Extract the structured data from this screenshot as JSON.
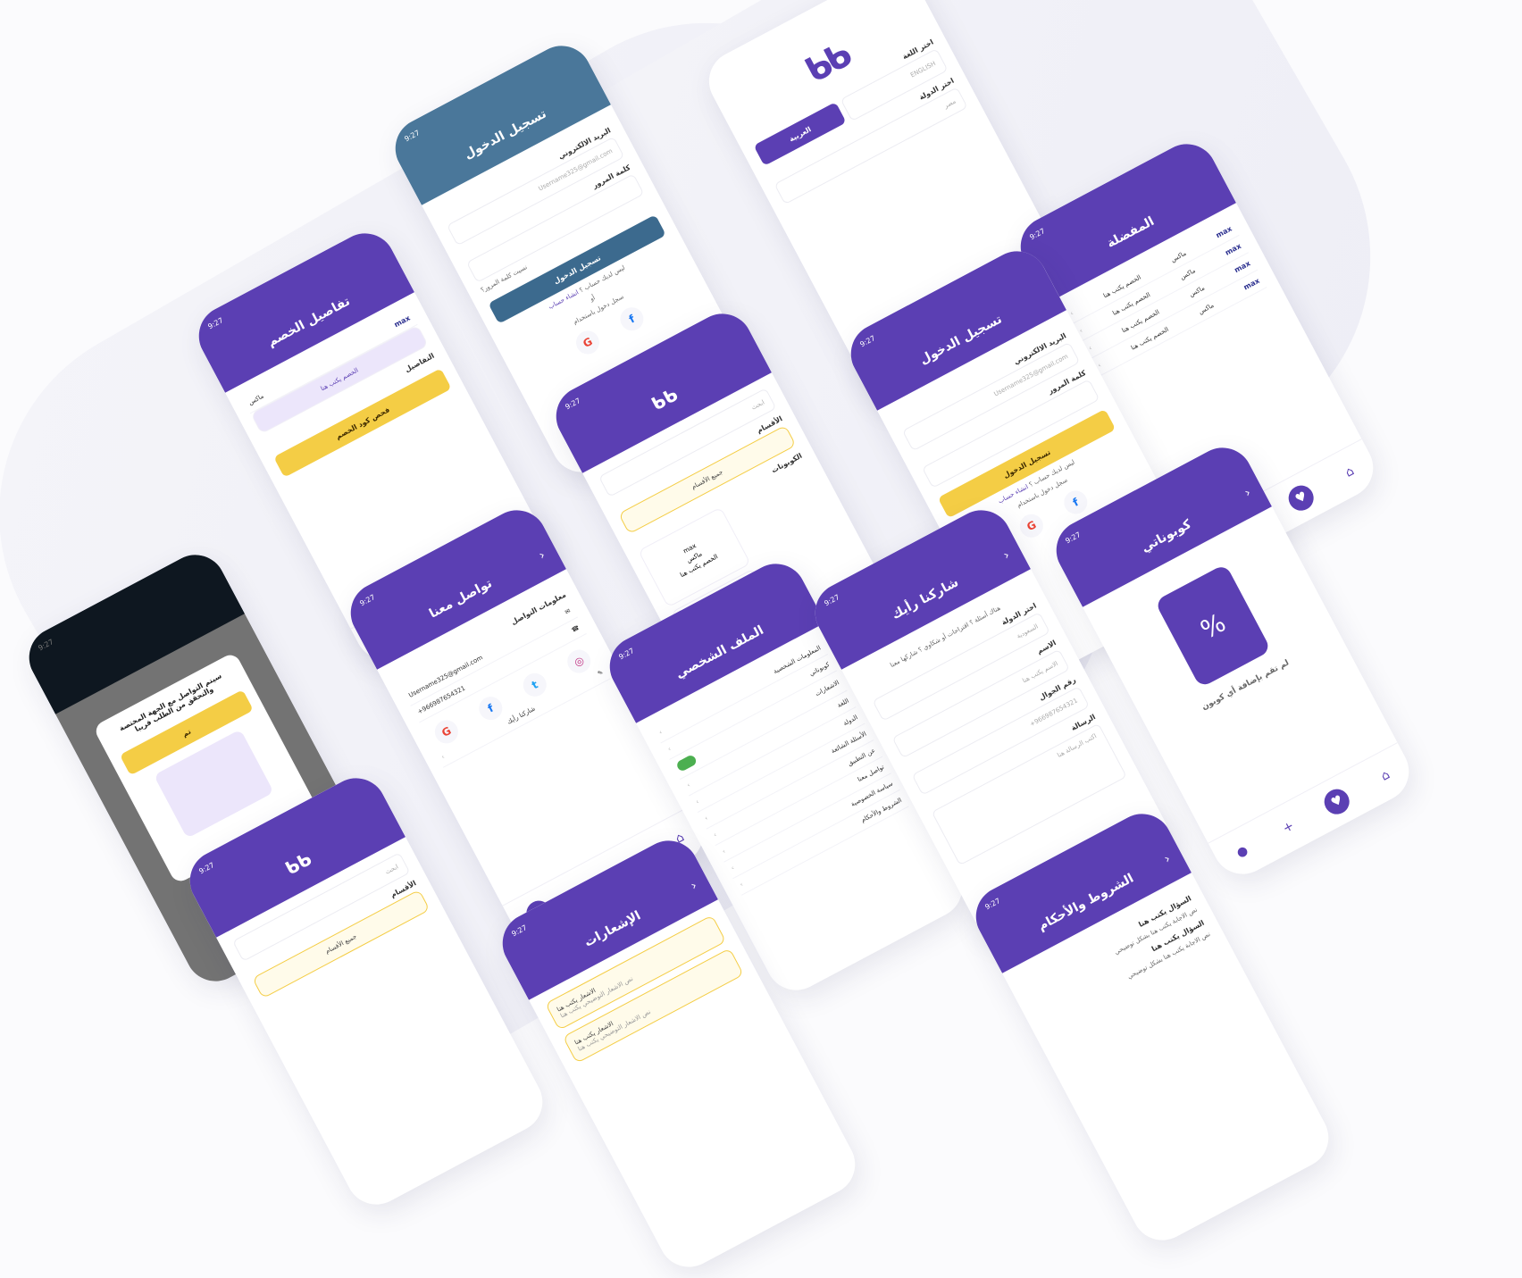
{
  "time": "9:27",
  "arrow": "›",
  "login": {
    "title": "تسجيل الدخول",
    "email_label": "البريد الالكتروني",
    "email_value": "Username325@gmail.com",
    "password_label": "كلمة المرور",
    "forgot": "نسيت كلمة المرور؟",
    "submit": "تسجيل الدخول",
    "no_account": "ليس لديك حساب ؟",
    "signup": "انشاء حساب",
    "or": "أو",
    "login_with": "سجل دخول باستخدام"
  },
  "language": {
    "english": "ENGLISH",
    "arabic": "العربية",
    "choose_lang": "اختر اللغة",
    "choose_country": "اختر الدولة",
    "country": "مصر"
  },
  "favorites": {
    "title": "المفضلة",
    "store": "ماكس",
    "desc": "الخصم يكتب هنا"
  },
  "discount": {
    "title": "تفاصيل الخصم",
    "store": "ماكس",
    "code_btn": "فحص كود الخصم",
    "badge": "الخصم يكتب هنا",
    "details": "التفاصيل"
  },
  "categories": {
    "search_placeholder": "ابحث",
    "title": "الأقسام",
    "all": "جميع الأقسام",
    "coupons": "الكوبونات",
    "store": "ماكس",
    "desc": "الخصم يكتب هنا"
  },
  "contact": {
    "title": "تواصل معنا",
    "info": "معلومات التواصل",
    "email": "Username325@gmail.com",
    "phone": "+966987654321",
    "share": "شاركنا رأيك"
  },
  "profile": {
    "title": "الملف الشخصي",
    "personal": "المعلومات الشخصية",
    "coupons": "كوبوناتي",
    "notifications": "الاشعارات",
    "language": "اللغة",
    "country": "الدولة",
    "faq": "الأسئلة الشائعة",
    "about": "عن التطبيق",
    "contact": "تواصل معنا",
    "privacy": "سياسة الخصوصية",
    "terms": "الشروط والأحكام"
  },
  "share": {
    "title": "شاركنا رأيك",
    "intro": "هناك أسئلة ؟ اقتراحات أو شكاوي ؟ شاركها معنا",
    "choose_country": "اختر الدولة",
    "country_value": "السعودية",
    "name_label": "الاسم",
    "name_ph": "الاسم يكتب هنا",
    "phone_label": "رقم الجوال",
    "phone_ph": "+966987654321",
    "message_label": "الرسالة",
    "message_ph": "اكتب الرسالة هنا"
  },
  "coupons": {
    "title": "كوبوناتي",
    "empty": "لم تقم بإضافة أي كوبون"
  },
  "notifications": {
    "title": "الإشعارات",
    "item": "الاشعار يكتب هنا",
    "item_sub": "نص الاشعار التوضيحي يكتب هنا"
  },
  "terms": {
    "title": "الشروط والأحكام",
    "q": "السؤال يكتب هنا",
    "a": "نص الاجابة يكتب هنا بشكل توضيحي"
  },
  "modal": {
    "message": "سيتم التواصل مع الجهة المختصة والتحقق من الطلب قريبا",
    "ok": "تم"
  },
  "brand": "max"
}
